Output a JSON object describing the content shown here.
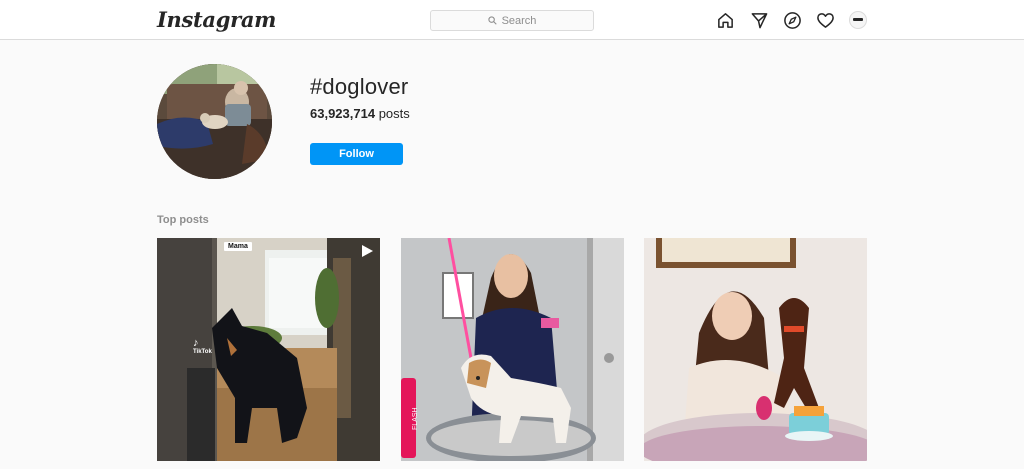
{
  "header": {
    "logo_text": "Instagram",
    "search": {
      "placeholder": "Search"
    },
    "nav_icons": [
      "home-icon",
      "direct-messages-icon",
      "explore-icon",
      "activity-heart-icon",
      "profile-avatar"
    ]
  },
  "hashtag": {
    "title": "#doglover",
    "post_count": "63,923,714",
    "posts_label": "posts",
    "follow_label": "Follow"
  },
  "top_posts": {
    "label": "Top posts",
    "items": [
      {
        "type": "video",
        "sticker_text": "Mama",
        "watermark": "TikTok"
      },
      {
        "type": "image",
        "can_text": "FLASH"
      },
      {
        "type": "image"
      }
    ]
  },
  "colors": {
    "accent": "#0095f6",
    "background": "#fafafa",
    "border": "#dbdbdb",
    "text": "#262626",
    "secondary_text": "#8e8e8e"
  }
}
